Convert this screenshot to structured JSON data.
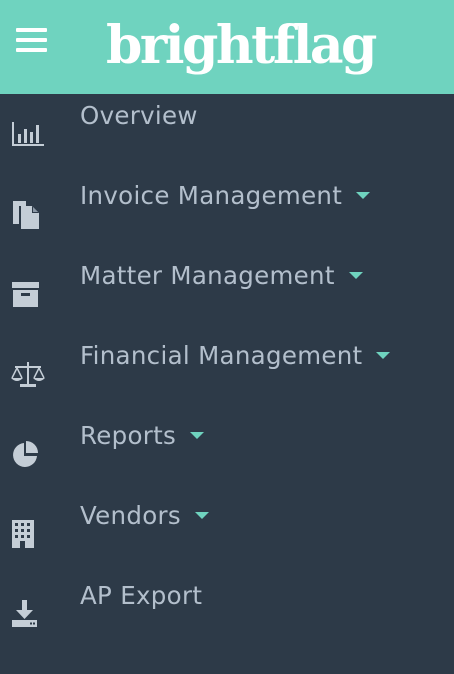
{
  "header": {
    "brand": "brightflag",
    "brand_color": "#6fd3bf"
  },
  "nav": {
    "items": [
      {
        "label": "Overview",
        "icon": "bar-chart-icon",
        "has_dropdown": false
      },
      {
        "label": "Invoice Management",
        "icon": "documents-icon",
        "has_dropdown": true
      },
      {
        "label": "Matter Management",
        "icon": "archive-box-icon",
        "has_dropdown": true
      },
      {
        "label": "Financial Management",
        "icon": "balance-scale-icon",
        "has_dropdown": true
      },
      {
        "label": "Reports",
        "icon": "pie-chart-icon",
        "has_dropdown": true
      },
      {
        "label": "Vendors",
        "icon": "building-icon",
        "has_dropdown": true
      },
      {
        "label": "AP Export",
        "icon": "download-icon",
        "has_dropdown": false
      }
    ]
  },
  "colors": {
    "sidebar_bg": "#2d3a48",
    "text": "#b3bfcc",
    "icon": "#c4cdd6",
    "accent": "#6fd3bf"
  }
}
